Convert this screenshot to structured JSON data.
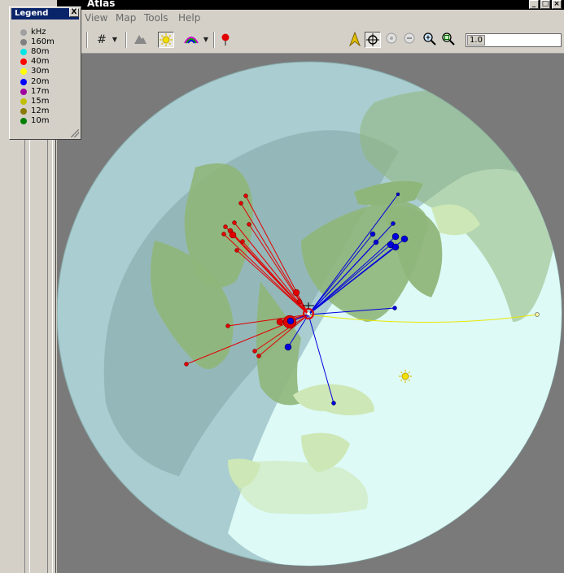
{
  "window": {
    "title": "Atlas"
  },
  "menu": {
    "items": [
      "View",
      "Map",
      "Tools",
      "Help"
    ]
  },
  "toolbar": {
    "zoom_value": "1.0",
    "icons": [
      "grid-icon",
      "dropdown-arrow-icon",
      "terrain-icon",
      "sun-icon",
      "propagation-icon",
      "dropdown-arrow-icon",
      "marker-icon",
      "compass-icon",
      "center-target-icon",
      "zoom-default-icon",
      "zoom-minus-icon",
      "zoom-in-icon",
      "zoom-fit-icon"
    ]
  },
  "legend": {
    "title": "Legend",
    "close_glyph": "X",
    "entries": [
      {
        "label": "kHz",
        "color": "#a0a0a0"
      },
      {
        "label": "160m",
        "color": "#808080"
      },
      {
        "label": "80m",
        "color": "#00e5e5"
      },
      {
        "label": "40m",
        "color": "#ff0000"
      },
      {
        "label": "30m",
        "color": "#ffff00"
      },
      {
        "label": "20m",
        "color": "#0000ff"
      },
      {
        "label": "17m",
        "color": "#a000a0"
      },
      {
        "label": "15m",
        "color": "#c0c000"
      },
      {
        "label": "12m",
        "color": "#8a7a00"
      },
      {
        "label": "10m",
        "color": "#008000"
      }
    ]
  },
  "map_colors": {
    "night": "#a9cdd0",
    "night_deep": "#8fb3b3",
    "day": "#ddfaf7",
    "land": "#8fb67a",
    "land_day": "#cde8b6",
    "band_40m": "#e00000",
    "band_20m": "#0000dd",
    "band_30m": "#e8e800"
  }
}
